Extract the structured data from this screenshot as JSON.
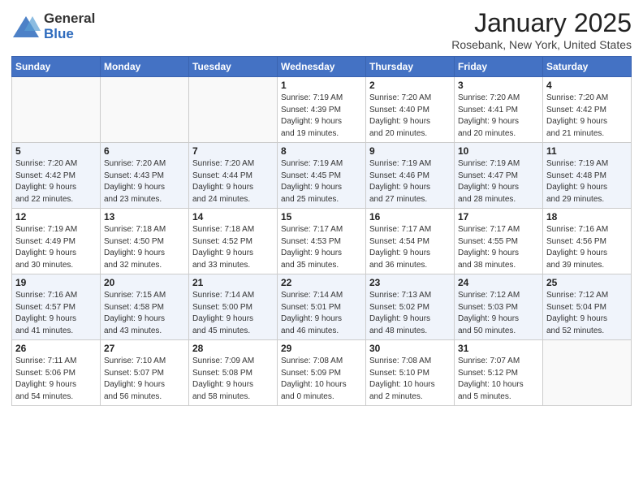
{
  "header": {
    "logo_general": "General",
    "logo_blue": "Blue",
    "month_title": "January 2025",
    "location": "Rosebank, New York, United States"
  },
  "weekdays": [
    "Sunday",
    "Monday",
    "Tuesday",
    "Wednesday",
    "Thursday",
    "Friday",
    "Saturday"
  ],
  "weeks": [
    [
      {
        "day": "",
        "info": ""
      },
      {
        "day": "",
        "info": ""
      },
      {
        "day": "",
        "info": ""
      },
      {
        "day": "1",
        "info": "Sunrise: 7:19 AM\nSunset: 4:39 PM\nDaylight: 9 hours\nand 19 minutes."
      },
      {
        "day": "2",
        "info": "Sunrise: 7:20 AM\nSunset: 4:40 PM\nDaylight: 9 hours\nand 20 minutes."
      },
      {
        "day": "3",
        "info": "Sunrise: 7:20 AM\nSunset: 4:41 PM\nDaylight: 9 hours\nand 20 minutes."
      },
      {
        "day": "4",
        "info": "Sunrise: 7:20 AM\nSunset: 4:42 PM\nDaylight: 9 hours\nand 21 minutes."
      }
    ],
    [
      {
        "day": "5",
        "info": "Sunrise: 7:20 AM\nSunset: 4:42 PM\nDaylight: 9 hours\nand 22 minutes."
      },
      {
        "day": "6",
        "info": "Sunrise: 7:20 AM\nSunset: 4:43 PM\nDaylight: 9 hours\nand 23 minutes."
      },
      {
        "day": "7",
        "info": "Sunrise: 7:20 AM\nSunset: 4:44 PM\nDaylight: 9 hours\nand 24 minutes."
      },
      {
        "day": "8",
        "info": "Sunrise: 7:19 AM\nSunset: 4:45 PM\nDaylight: 9 hours\nand 25 minutes."
      },
      {
        "day": "9",
        "info": "Sunrise: 7:19 AM\nSunset: 4:46 PM\nDaylight: 9 hours\nand 27 minutes."
      },
      {
        "day": "10",
        "info": "Sunrise: 7:19 AM\nSunset: 4:47 PM\nDaylight: 9 hours\nand 28 minutes."
      },
      {
        "day": "11",
        "info": "Sunrise: 7:19 AM\nSunset: 4:48 PM\nDaylight: 9 hours\nand 29 minutes."
      }
    ],
    [
      {
        "day": "12",
        "info": "Sunrise: 7:19 AM\nSunset: 4:49 PM\nDaylight: 9 hours\nand 30 minutes."
      },
      {
        "day": "13",
        "info": "Sunrise: 7:18 AM\nSunset: 4:50 PM\nDaylight: 9 hours\nand 32 minutes."
      },
      {
        "day": "14",
        "info": "Sunrise: 7:18 AM\nSunset: 4:52 PM\nDaylight: 9 hours\nand 33 minutes."
      },
      {
        "day": "15",
        "info": "Sunrise: 7:17 AM\nSunset: 4:53 PM\nDaylight: 9 hours\nand 35 minutes."
      },
      {
        "day": "16",
        "info": "Sunrise: 7:17 AM\nSunset: 4:54 PM\nDaylight: 9 hours\nand 36 minutes."
      },
      {
        "day": "17",
        "info": "Sunrise: 7:17 AM\nSunset: 4:55 PM\nDaylight: 9 hours\nand 38 minutes."
      },
      {
        "day": "18",
        "info": "Sunrise: 7:16 AM\nSunset: 4:56 PM\nDaylight: 9 hours\nand 39 minutes."
      }
    ],
    [
      {
        "day": "19",
        "info": "Sunrise: 7:16 AM\nSunset: 4:57 PM\nDaylight: 9 hours\nand 41 minutes."
      },
      {
        "day": "20",
        "info": "Sunrise: 7:15 AM\nSunset: 4:58 PM\nDaylight: 9 hours\nand 43 minutes."
      },
      {
        "day": "21",
        "info": "Sunrise: 7:14 AM\nSunset: 5:00 PM\nDaylight: 9 hours\nand 45 minutes."
      },
      {
        "day": "22",
        "info": "Sunrise: 7:14 AM\nSunset: 5:01 PM\nDaylight: 9 hours\nand 46 minutes."
      },
      {
        "day": "23",
        "info": "Sunrise: 7:13 AM\nSunset: 5:02 PM\nDaylight: 9 hours\nand 48 minutes."
      },
      {
        "day": "24",
        "info": "Sunrise: 7:12 AM\nSunset: 5:03 PM\nDaylight: 9 hours\nand 50 minutes."
      },
      {
        "day": "25",
        "info": "Sunrise: 7:12 AM\nSunset: 5:04 PM\nDaylight: 9 hours\nand 52 minutes."
      }
    ],
    [
      {
        "day": "26",
        "info": "Sunrise: 7:11 AM\nSunset: 5:06 PM\nDaylight: 9 hours\nand 54 minutes."
      },
      {
        "day": "27",
        "info": "Sunrise: 7:10 AM\nSunset: 5:07 PM\nDaylight: 9 hours\nand 56 minutes."
      },
      {
        "day": "28",
        "info": "Sunrise: 7:09 AM\nSunset: 5:08 PM\nDaylight: 9 hours\nand 58 minutes."
      },
      {
        "day": "29",
        "info": "Sunrise: 7:08 AM\nSunset: 5:09 PM\nDaylight: 10 hours\nand 0 minutes."
      },
      {
        "day": "30",
        "info": "Sunrise: 7:08 AM\nSunset: 5:10 PM\nDaylight: 10 hours\nand 2 minutes."
      },
      {
        "day": "31",
        "info": "Sunrise: 7:07 AM\nSunset: 5:12 PM\nDaylight: 10 hours\nand 5 minutes."
      },
      {
        "day": "",
        "info": ""
      }
    ]
  ]
}
